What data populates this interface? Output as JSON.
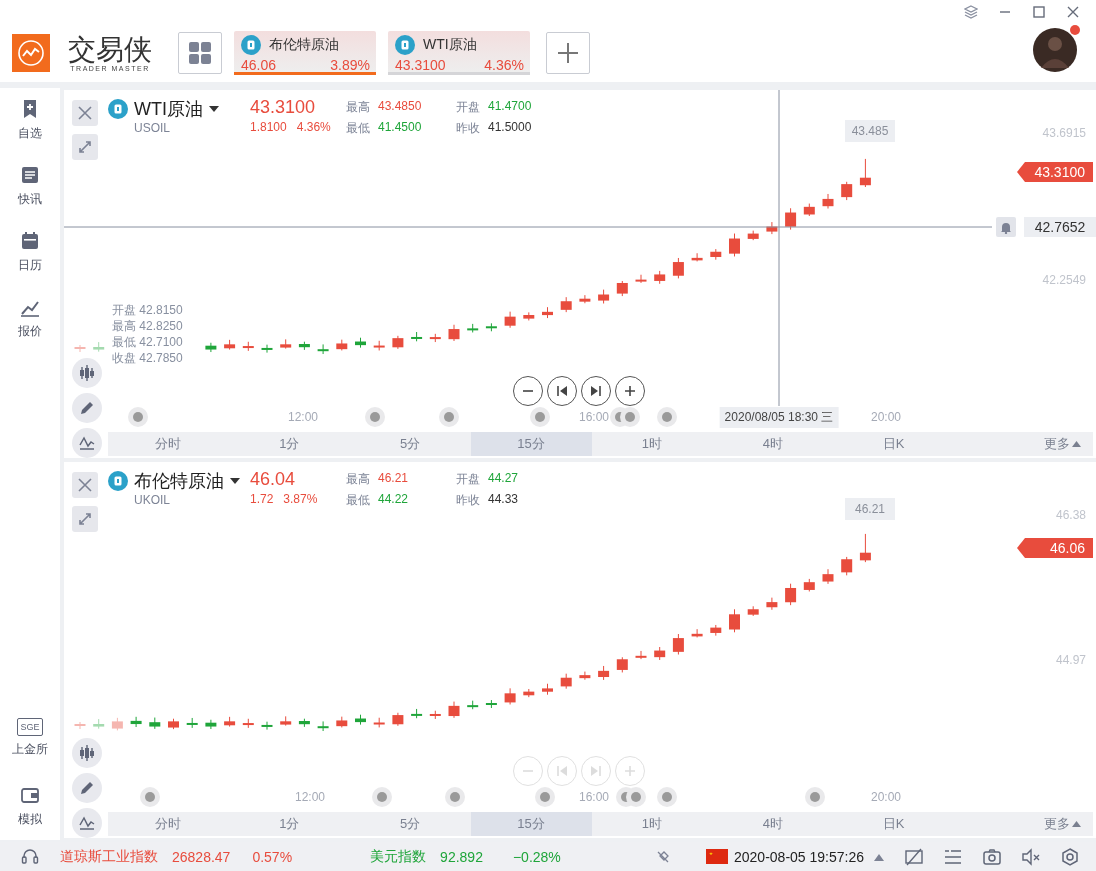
{
  "app": {
    "name": "交易侠",
    "subtitle": "TRADER MASTER"
  },
  "tabs": [
    {
      "name": "布伦特原油",
      "price": "46.06",
      "change": "3.89%",
      "selected": true
    },
    {
      "name": "WTI原油",
      "price": "43.3100",
      "change": "4.36%",
      "selected": false
    }
  ],
  "sidebar": {
    "items": [
      {
        "label": "自选"
      },
      {
        "label": "快讯"
      },
      {
        "label": "日历"
      },
      {
        "label": "报价"
      }
    ],
    "bottom_items": [
      {
        "label": "上金所",
        "badge": "SGE"
      },
      {
        "label": "模拟"
      }
    ]
  },
  "charts": [
    {
      "name": "WTI原油",
      "code": "USOIL",
      "price": "43.3100",
      "change": "1.8100",
      "change_pct": "4.36%",
      "stats": [
        {
          "label": "最高",
          "value": "43.4850",
          "color": "#e84c3d"
        },
        {
          "label": "开盘",
          "value": "41.4700",
          "color": "#1fa53a"
        },
        {
          "label": "最低",
          "value": "41.4500",
          "color": "#1fa53a"
        },
        {
          "label": "昨收",
          "value": "41.5000",
          "color": "#333333"
        }
      ],
      "axis_labels": [
        "43.6915",
        "42.2549"
      ],
      "last_price": "43.3100",
      "peak_label": "43.485",
      "crosshair": {
        "price": "42.7652",
        "time": "2020/08/05 18:30 三"
      },
      "ohlc_overlay": [
        "开盘 42.8150",
        "最高 42.8250",
        "最低 42.7100",
        "收盘 42.7850"
      ],
      "zoom_controls_faded": false,
      "times": [
        "12:00",
        "16:00",
        "20:00"
      ],
      "periods": [
        {
          "label": "分时",
          "selected": false
        },
        {
          "label": "1分",
          "selected": false
        },
        {
          "label": "5分",
          "selected": false
        },
        {
          "label": "15分",
          "selected": true
        },
        {
          "label": "1时",
          "selected": false
        },
        {
          "label": "4时",
          "selected": false
        },
        {
          "label": "日K",
          "selected": false
        }
      ],
      "more": "更多"
    },
    {
      "name": "布伦特原油",
      "code": "UKOIL",
      "price": "46.04",
      "change": "1.72",
      "change_pct": "3.87%",
      "stats": [
        {
          "label": "最高",
          "value": "46.21",
          "color": "#e84c3d"
        },
        {
          "label": "开盘",
          "value": "44.27",
          "color": "#1fa53a"
        },
        {
          "label": "最低",
          "value": "44.22",
          "color": "#1fa53a"
        },
        {
          "label": "昨收",
          "value": "44.33",
          "color": "#333333"
        }
      ],
      "axis_labels": [
        "46.38",
        "44.97"
      ],
      "last_price": "46.06",
      "peak_label": "46.21",
      "zoom_controls_faded": true,
      "times": [
        "12:00",
        "16:00",
        "20:00"
      ],
      "periods": [
        {
          "label": "分时",
          "selected": false
        },
        {
          "label": "1分",
          "selected": false
        },
        {
          "label": "5分",
          "selected": false
        },
        {
          "label": "15分",
          "selected": true
        },
        {
          "label": "1时",
          "selected": false
        },
        {
          "label": "4时",
          "selected": false
        },
        {
          "label": "日K",
          "selected": false
        }
      ],
      "more": "更多"
    }
  ],
  "status_bar": {
    "tickers": [
      {
        "name": "道琼斯工业指数",
        "value": "26828.47",
        "change": "0.57%",
        "color": "#e84c3d"
      },
      {
        "name": "美元指数",
        "value": "92.892",
        "change": "−0.28%",
        "color": "#1fa53a"
      }
    ],
    "datetime": "2020-08-05 19:57:26"
  }
}
